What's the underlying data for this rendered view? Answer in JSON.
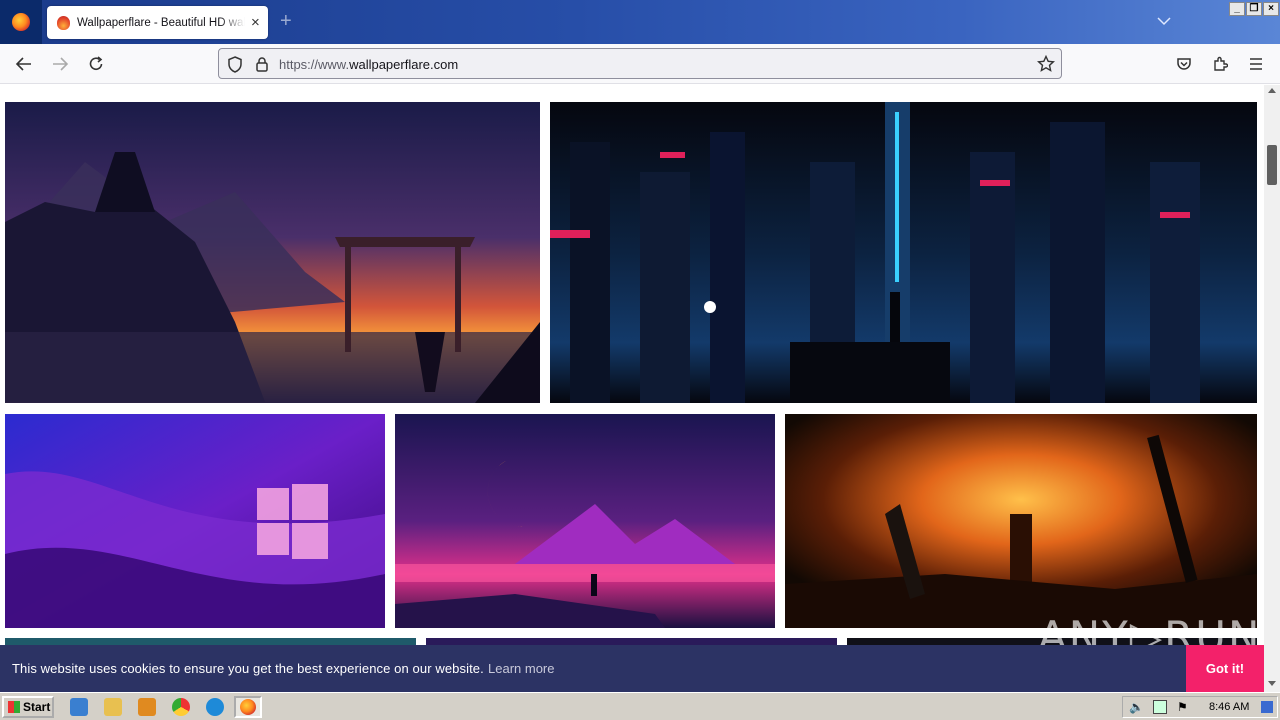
{
  "browser": {
    "tab_title": "Wallpaperflare - Beautiful HD wallpapers",
    "tab_close": "×",
    "new_tab": "+",
    "url_prefix": "https://www.",
    "url_domain": "wallpaperflare.com"
  },
  "window_controls": {
    "minimize": "_",
    "restore": "❐",
    "close": "×"
  },
  "cookie_bar": {
    "message": "This website uses cookies to ensure you get the best experience on our website.",
    "learn_more": "Learn more",
    "button": "Got it!"
  },
  "watermark": "ANY▷RUN",
  "taskbar": {
    "start": "Start",
    "clock": "8:46 AM"
  },
  "colors": {
    "accent": "#f3216a",
    "cookie_bg": "#2c3364",
    "tabbar": "#274ea8"
  },
  "gallery": [
    {
      "name": "samurai-torii-night",
      "colors": [
        "#1a1840",
        "#4a2f6a",
        "#d2553a",
        "#f79a3a"
      ]
    },
    {
      "name": "cyberpunk-city",
      "colors": [
        "#05070f",
        "#0c2240",
        "#1a7fc0",
        "#e0205a"
      ]
    },
    {
      "name": "windows-11-purple",
      "colors": [
        "#2b2bd0",
        "#6a1fc8",
        "#c43cc8",
        "#3a0a7a"
      ]
    },
    {
      "name": "synthwave-mountains",
      "colors": [
        "#1a1550",
        "#5a2080",
        "#e0308a",
        "#f2a040"
      ]
    },
    {
      "name": "burning-tree",
      "colors": [
        "#120904",
        "#5a1e06",
        "#e2661a",
        "#ffc04a"
      ]
    }
  ]
}
